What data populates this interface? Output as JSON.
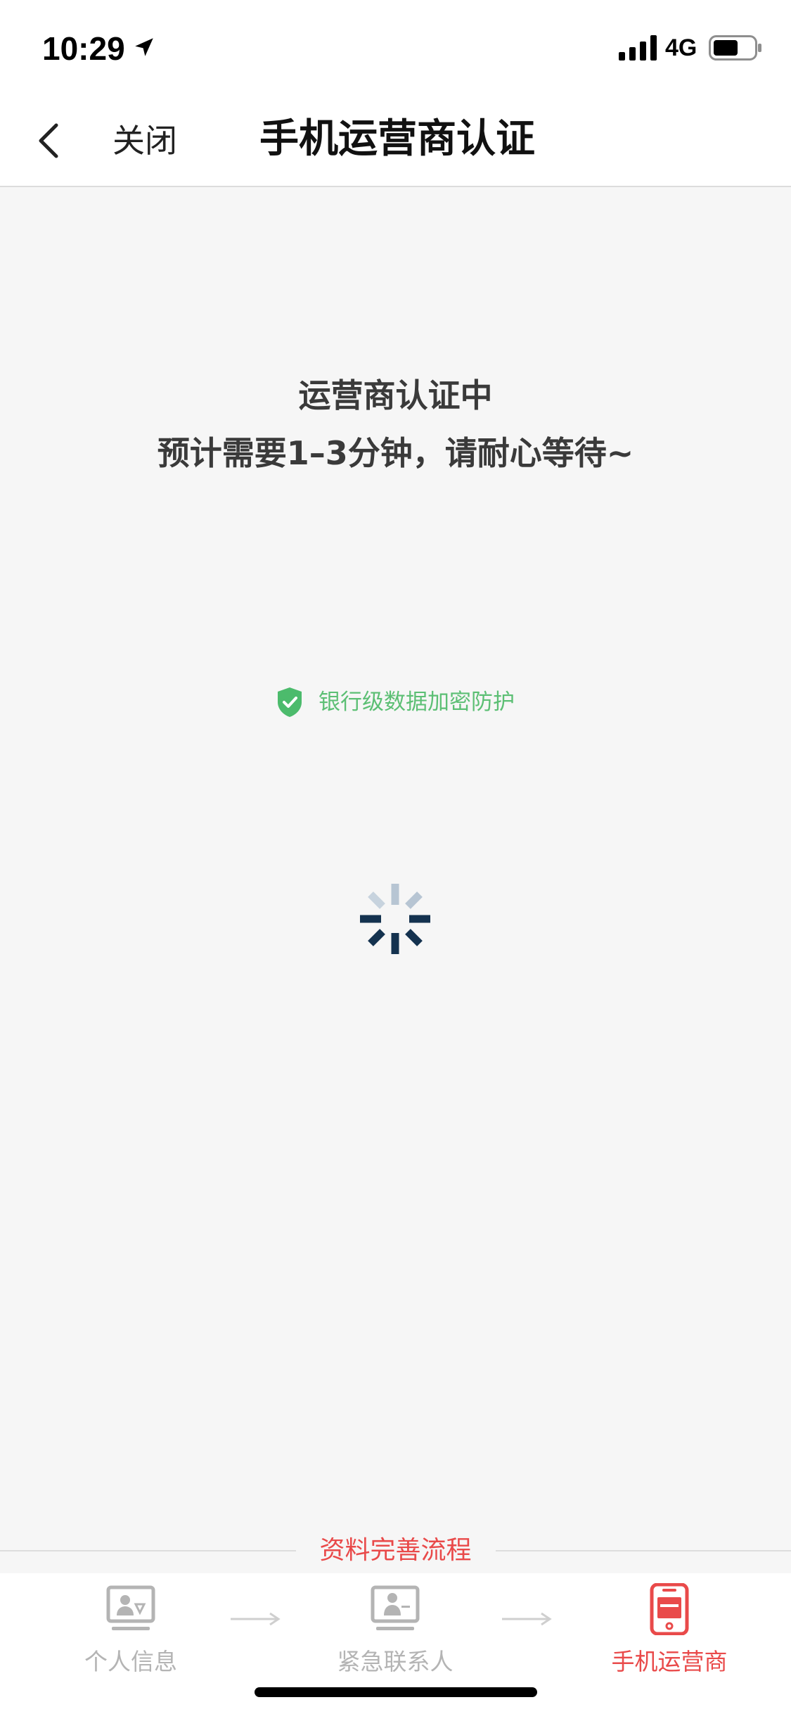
{
  "status_bar": {
    "time": "10:29",
    "network": "4G",
    "icons": [
      "location-arrow-icon",
      "signal-icon",
      "battery-icon"
    ]
  },
  "nav": {
    "back_icon": "chevron-left-icon",
    "close_label": "关闭",
    "title": "手机运营商认证"
  },
  "status": {
    "title": "运营商认证中",
    "subtitle": "预计需要1–3分钟，请耐心等待~",
    "loading_icon": "spinner-icon"
  },
  "security": {
    "text": "银行级数据加密防护",
    "icon": "shield-check-icon"
  },
  "flow": {
    "title": "资料完善流程",
    "steps": [
      {
        "label": "个人信息",
        "icon": "id-card-icon",
        "active": false
      },
      {
        "label": "紧急联系人",
        "icon": "contact-card-icon",
        "active": false
      },
      {
        "label": "手机运营商",
        "icon": "phone-icon",
        "active": true
      }
    ]
  },
  "colors": {
    "accent": "#e94a4a",
    "secure_green": "#5cbf74",
    "inactive_gray": "#b4b4b4",
    "background": "#f6f6f6",
    "spinner_dark": "#14324f",
    "spinner_light": "#b7c5d3"
  }
}
